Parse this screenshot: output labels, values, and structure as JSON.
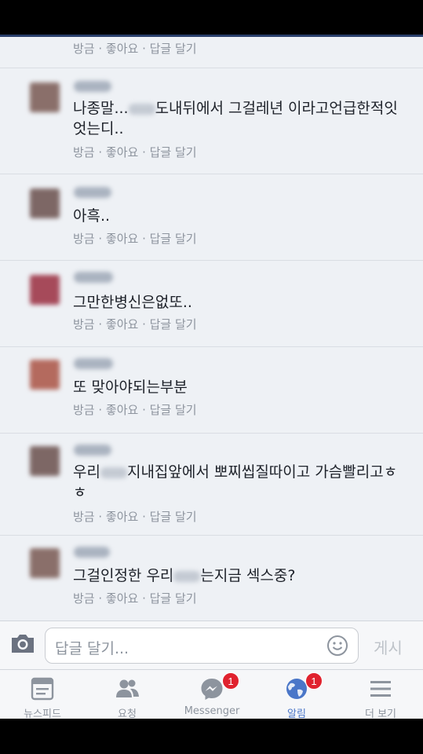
{
  "meta_text": "방금 · 좋아요 · 답글 달기",
  "comments": [
    {
      "text": "나종말...",
      "text_after": "도내뒤에서 그걸레년 이라고언급한적잇엇는디..",
      "avatar_color": "#8a6f6a"
    },
    {
      "text": "아흑..",
      "avatar_color": "#7d6765"
    },
    {
      "text": "그만한병신은없또..",
      "avatar_color": "#a64a5a"
    },
    {
      "text": "또 맞아야되는부분",
      "avatar_color": "#b46a5e"
    },
    {
      "text": "우리",
      "text_after": "지내집앞에서 뽀찌씹질따이고 가슴빨리고ㅎㅎ",
      "avatar_color": "#7d6765"
    },
    {
      "text": "그걸인정한 우리",
      "text_after": "는지금 섹스중?",
      "avatar_color": "#8a6f6a"
    }
  ],
  "composer": {
    "placeholder": "답글 달기...",
    "post_label": "게시",
    "camera_icon": "camera-icon",
    "emoji_icon": "smiley-icon"
  },
  "tabs": [
    {
      "label": "뉴스피드",
      "icon": "newsfeed-icon",
      "badge": ""
    },
    {
      "label": "요청",
      "icon": "friend-requests-icon",
      "badge": ""
    },
    {
      "label": "Messenger",
      "icon": "messenger-icon",
      "badge": "1"
    },
    {
      "label": "알림",
      "icon": "globe-icon",
      "badge": "1",
      "active": true
    },
    {
      "label": "더 보기",
      "icon": "menu-icon",
      "badge": ""
    }
  ],
  "colors": {
    "accent": "#4a76c8",
    "badge": "#e0222e",
    "background": "#eef1f5"
  }
}
